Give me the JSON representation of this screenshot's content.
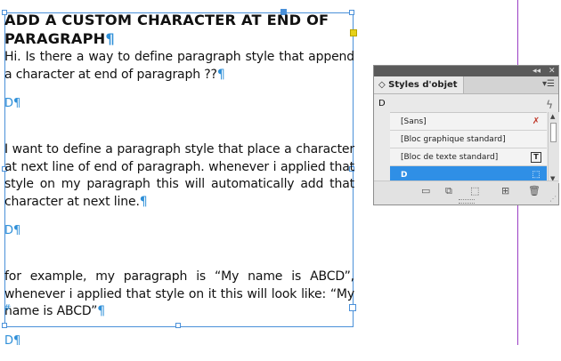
{
  "document": {
    "heading": "ADD A CUSTOM CHARACTER AT END OF PARAGRAPH",
    "pilcrow": "¶",
    "paragraphs": [
      "Hi. Is there a way to define paragraph style that append a character at end of paragraph ??",
      "D",
      "",
      "I want to define a paragraph style that place a character at next line of end of paragraph. whenever i applied that style on my paragraph this will automatically add that character at next line.",
      "D",
      "",
      "for example, my paragraph is “My name is ABCD”, whenever i applied that style on it this will look like: “My name is ABCD”",
      "D"
    ],
    "end_marker": "#"
  },
  "panel": {
    "title": "Styles d'objet",
    "collapse_label": "◂◂",
    "close_label": "✕",
    "current_style": "D",
    "styles": [
      {
        "name": "[Sans]",
        "icon": "no-style-icon",
        "icon_glyph": "✗"
      },
      {
        "name": "[Bloc graphique standard]",
        "icon": "",
        "icon_glyph": ""
      },
      {
        "name": "[Bloc de texte standard]",
        "icon": "text-frame-icon",
        "icon_glyph": "T"
      },
      {
        "name": "D",
        "icon": "frame-icon",
        "icon_glyph": "⬚",
        "selected": true
      }
    ],
    "colors": {
      "selected": "#2f8fe6",
      "guide": "#9a3fc4",
      "frame": "#4a90d9"
    }
  }
}
